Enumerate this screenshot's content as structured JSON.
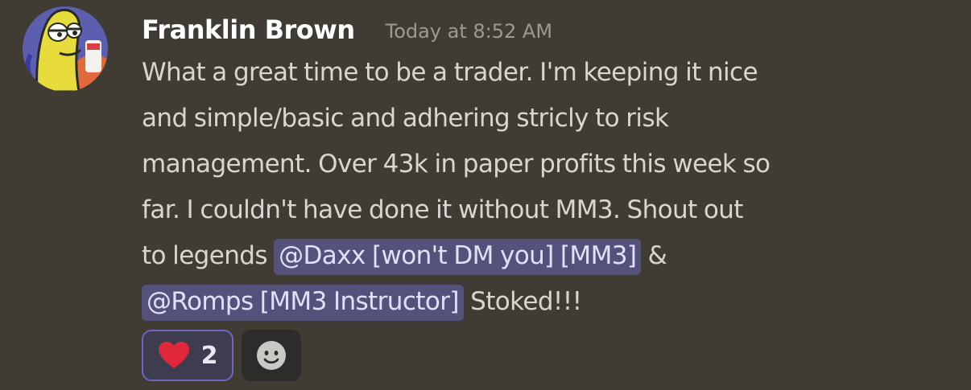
{
  "message": {
    "author": "Franklin Brown",
    "timestamp": "Today at 8:52 AM",
    "avatar_icon": "cartoon-fish-avatar",
    "lines": [
      [
        {
          "type": "text",
          "text": "What a great time to be a trader. I'm keeping it nice"
        }
      ],
      [
        {
          "type": "text",
          "text": "and simple/basic and adhering stricly to risk"
        }
      ],
      [
        {
          "type": "text",
          "text": "management. Over 43k in paper profits this week so"
        }
      ],
      [
        {
          "type": "text",
          "text": "far. I couldn't have done it without MM3. Shout out"
        }
      ],
      [
        {
          "type": "text",
          "text": "to legends "
        },
        {
          "type": "mention",
          "text": "@Daxx [won't DM you] [MM3]"
        },
        {
          "type": "text",
          "text": " &"
        }
      ],
      [
        {
          "type": "mention",
          "text": "@Romps [MM3 Instructor]"
        },
        {
          "type": "text",
          "text": " Stoked!!!"
        }
      ]
    ]
  },
  "reactions": [
    {
      "emoji": "heart-icon",
      "count": "2",
      "color": "#e0283a"
    }
  ],
  "add_reaction": {
    "icon": "smiley-icon"
  },
  "colors": {
    "background": "#403c34",
    "mention_bg": "#54527a",
    "reaction_border": "#6a68c4"
  }
}
